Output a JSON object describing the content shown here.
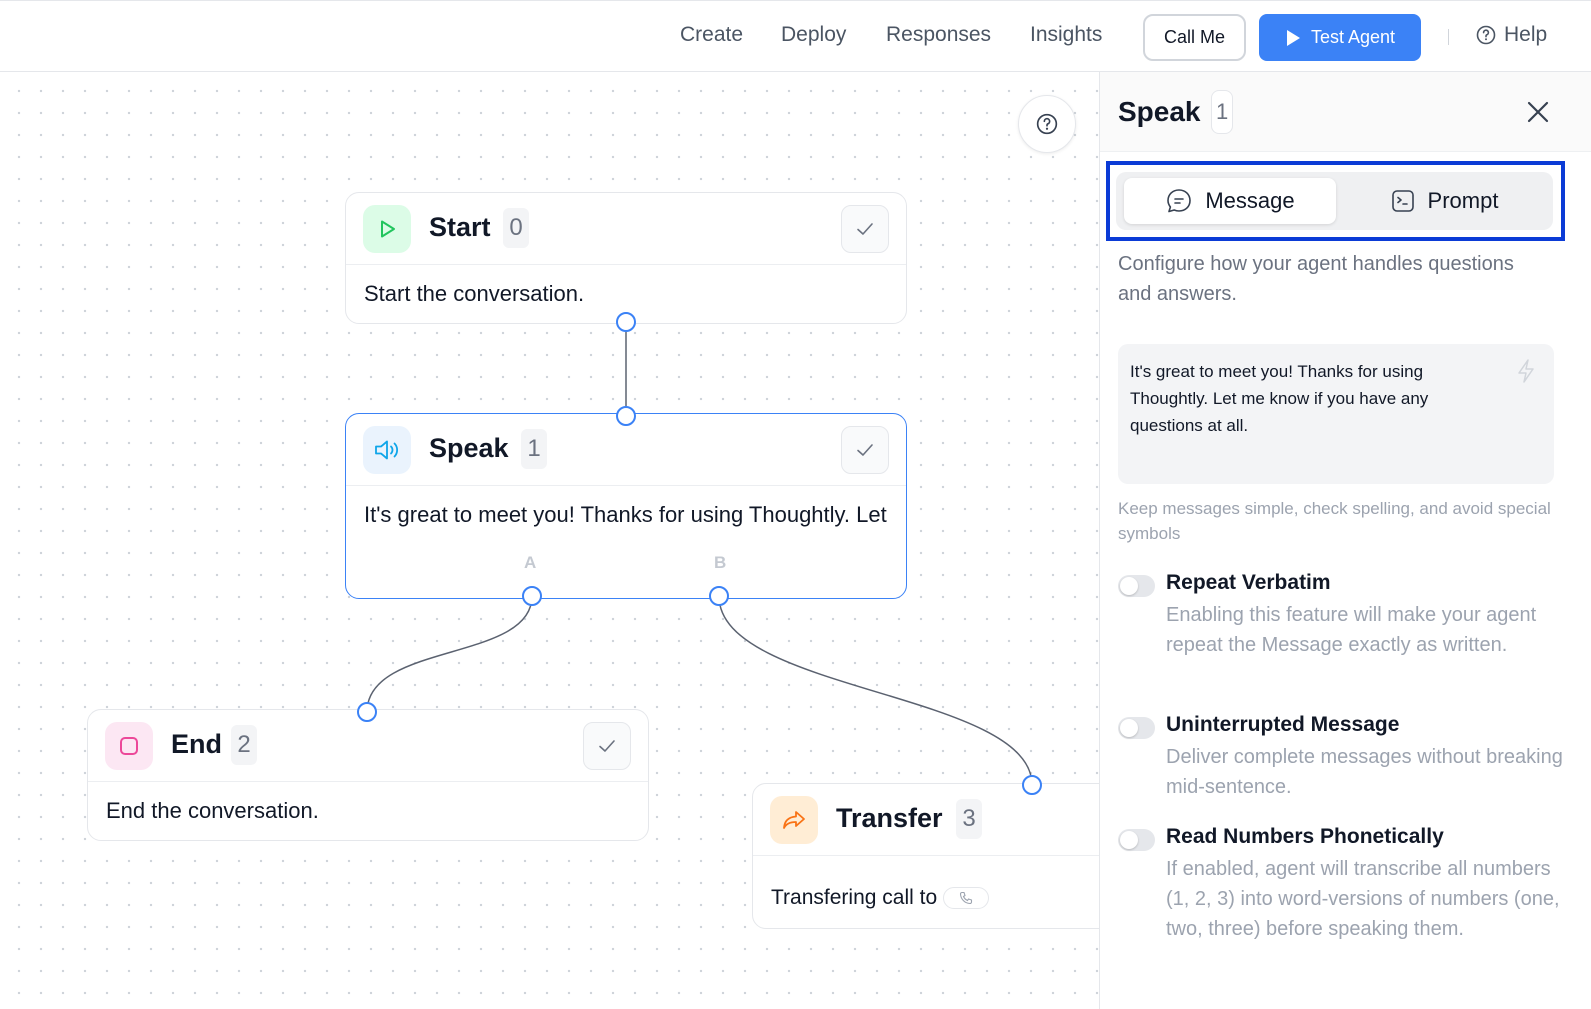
{
  "topbar": {
    "nav": [
      "Create",
      "Deploy",
      "Responses",
      "Insights"
    ],
    "call_me_label": "Call Me",
    "test_agent_label": "Test Agent",
    "help_label": "Help"
  },
  "nodes": {
    "start": {
      "title": "Start",
      "badge": "0",
      "body": "Start the conversation."
    },
    "speak": {
      "title": "Speak",
      "badge": "1",
      "body": "It's great to meet you! Thanks for using Thoughtly. Let me know if you have any questions at all.",
      "port_a": "A",
      "port_b": "B"
    },
    "end": {
      "title": "End",
      "badge": "2",
      "body": "End the conversation."
    },
    "transfer": {
      "title": "Transfer",
      "badge": "3",
      "body": "Transfering call to"
    }
  },
  "panel": {
    "title": "Speak",
    "badge": "1",
    "tabs": {
      "message": "Message",
      "prompt": "Prompt"
    },
    "description": "Configure how your agent handles questions and answers.",
    "message_text": "It's great to meet you! Thanks for using Thoughtly. Let me know if you have any questions at all.",
    "hint": "Keep messages simple, check spelling, and avoid special symbols",
    "toggles": [
      {
        "title": "Repeat Verbatim",
        "desc": "Enabling this feature will make your agent repeat the Message exactly as written."
      },
      {
        "title": "Uninterrupted Message",
        "desc": "Deliver complete messages without breaking mid-sentence."
      },
      {
        "title": "Read Numbers Phonetically",
        "desc": "If enabled, agent will transcribe all numbers (1, 2, 3) into word-versions of numbers (one, two, three) before speaking them."
      }
    ]
  },
  "colors": {
    "accent": "#3b82f6",
    "highlight_outline": "#0b3bd6",
    "start_icon": "#22c55e",
    "end_icon": "#ec4899",
    "transfer_icon": "#f97316"
  }
}
